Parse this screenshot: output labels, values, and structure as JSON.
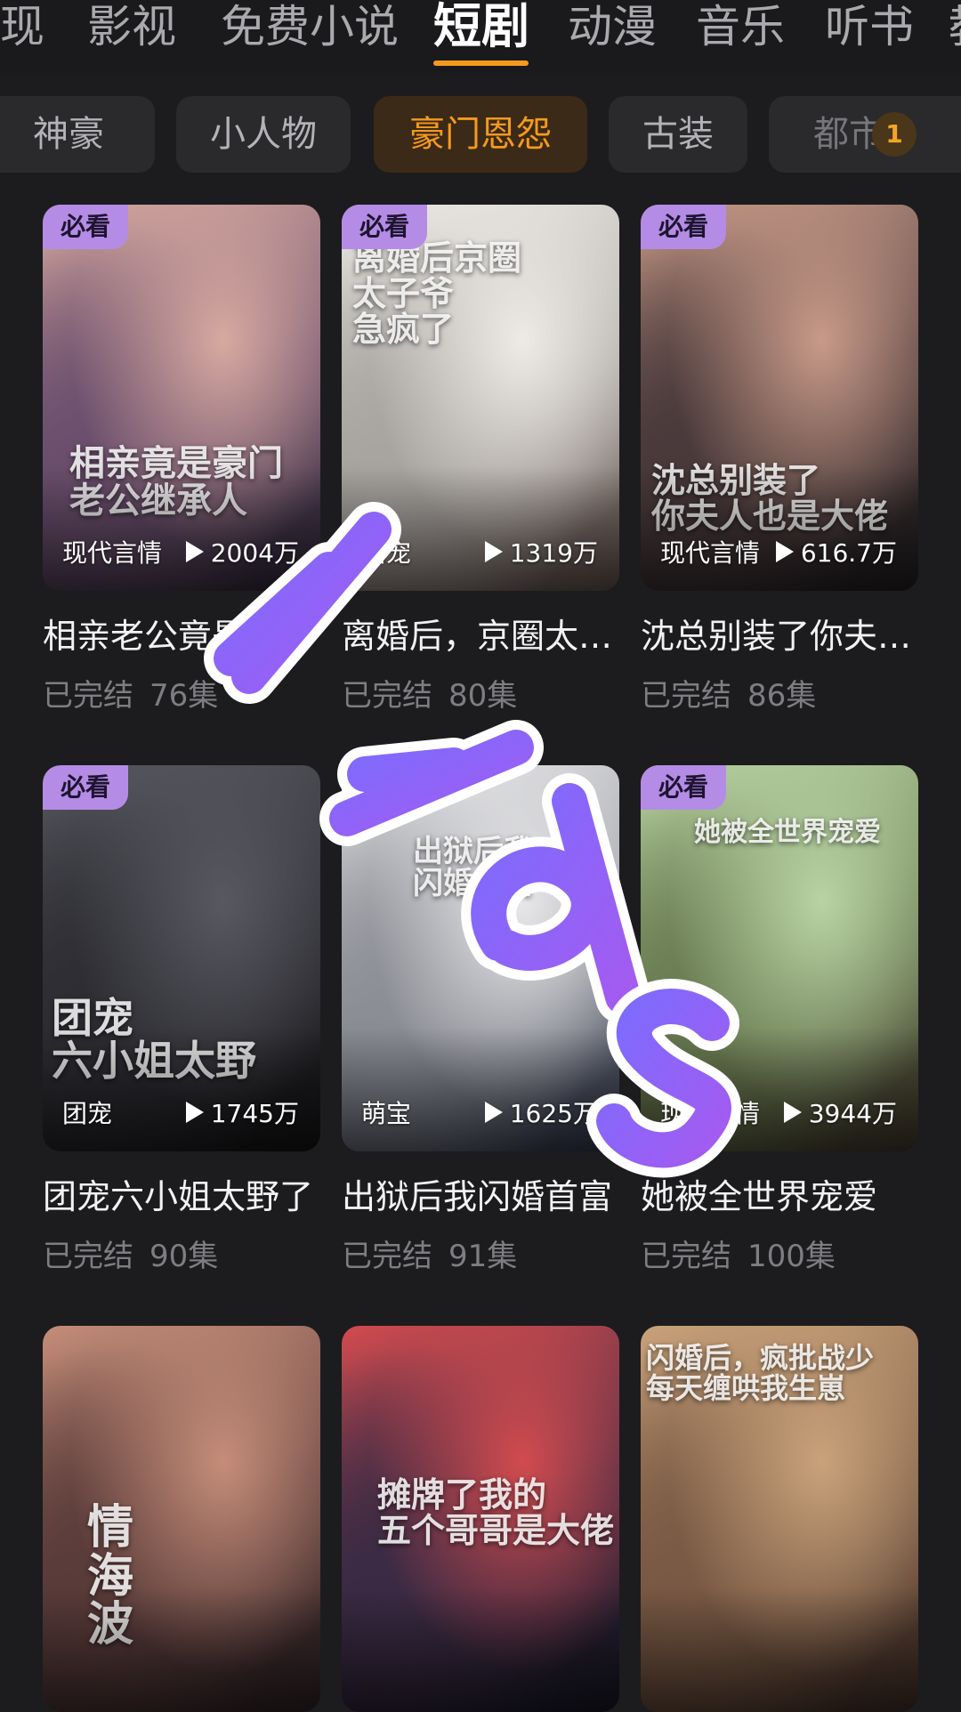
{
  "top_tabs": [
    {
      "label": "现",
      "active": false
    },
    {
      "label": "影视",
      "active": false
    },
    {
      "label": "免费小说",
      "active": false
    },
    {
      "label": "短剧",
      "active": true
    },
    {
      "label": "动漫",
      "active": false
    },
    {
      "label": "音乐",
      "active": false
    },
    {
      "label": "听书",
      "active": false
    },
    {
      "label": "教",
      "active": false
    }
  ],
  "sub_tabs": [
    {
      "label": "神豪",
      "active": false
    },
    {
      "label": "小人物",
      "active": false
    },
    {
      "label": "豪门恩怨",
      "active": true
    },
    {
      "label": "古装",
      "active": false
    },
    {
      "label": "都市",
      "active": false
    }
  ],
  "sub_tabs_badge": "1",
  "cards": [
    {
      "badge": "必看",
      "genre": "现代言情",
      "plays": "2004万",
      "title": "相亲老公竟是豪门继承人",
      "status": "已完结",
      "episodes": "76集",
      "poster_text": "相亲竟是豪门\n老公继承人",
      "colors": [
        "#d7a9a0",
        "#6b4f6d",
        "#2b2433"
      ]
    },
    {
      "badge": "必看",
      "genre": "甜宠",
      "plays": "1319万",
      "title": "离婚后，京圈太子爷急疯了",
      "status": "已完结",
      "episodes": "80集",
      "poster_text": "离婚后京圈\n太子爷\n急疯了",
      "colors": [
        "#eeeae6",
        "#a9a6a2",
        "#5c4a45"
      ]
    },
    {
      "badge": "必看",
      "genre": "现代言情",
      "plays": "616.7万",
      "title": "沈总别装了你夫人也是大佬",
      "status": "已完结",
      "episodes": "86集",
      "poster_text": "沈总别装了\n你夫人也是大佬",
      "colors": [
        "#c89a88",
        "#4a3a3b",
        "#1f1c1e"
      ]
    },
    {
      "badge": "必看",
      "genre": "团宠",
      "plays": "1745万",
      "title": "团宠六小姐太野了",
      "status": "已完结",
      "episodes": "90集",
      "poster_text": "团宠\n六小姐太野",
      "colors": [
        "#585860",
        "#2d2d33",
        "#121214"
      ]
    },
    {
      "badge": "",
      "genre": "萌宝",
      "plays": "1625万",
      "title": "出狱后我闪婚首富",
      "status": "已完结",
      "episodes": "91集",
      "poster_text": "出狱后我\n闪婚首富",
      "colors": [
        "#e8e8ea",
        "#8d8f96",
        "#2b3144"
      ]
    },
    {
      "badge": "必看",
      "genre": "现代言情",
      "plays": "3944万",
      "title": "她被全世界宠爱",
      "status": "已完结",
      "episodes": "100集",
      "poster_text": "她被全世界宠爱",
      "colors": [
        "#b9d3a4",
        "#6a7d52",
        "#3b3127"
      ]
    },
    {
      "badge": "",
      "genre": "",
      "plays": "",
      "title": "",
      "status": "",
      "episodes": "",
      "poster_text": "情\n海\n波",
      "colors": [
        "#c58d79",
        "#5a3c3a",
        "#2a1f22"
      ]
    },
    {
      "badge": "",
      "genre": "",
      "plays": "",
      "title": "",
      "status": "",
      "episodes": "",
      "poster_text": "摊牌了我的\n五个哥哥是大佬",
      "colors": [
        "#d14b4f",
        "#3c2b44",
        "#151521"
      ]
    },
    {
      "badge": "",
      "genre": "",
      "plays": "",
      "title": "",
      "status": "",
      "episodes": "",
      "poster_text": "闪婚后，疯批战少\n每天缠哄我生崽",
      "colors": [
        "#c9a27a",
        "#7a5a45",
        "#3b2a23"
      ]
    }
  ]
}
